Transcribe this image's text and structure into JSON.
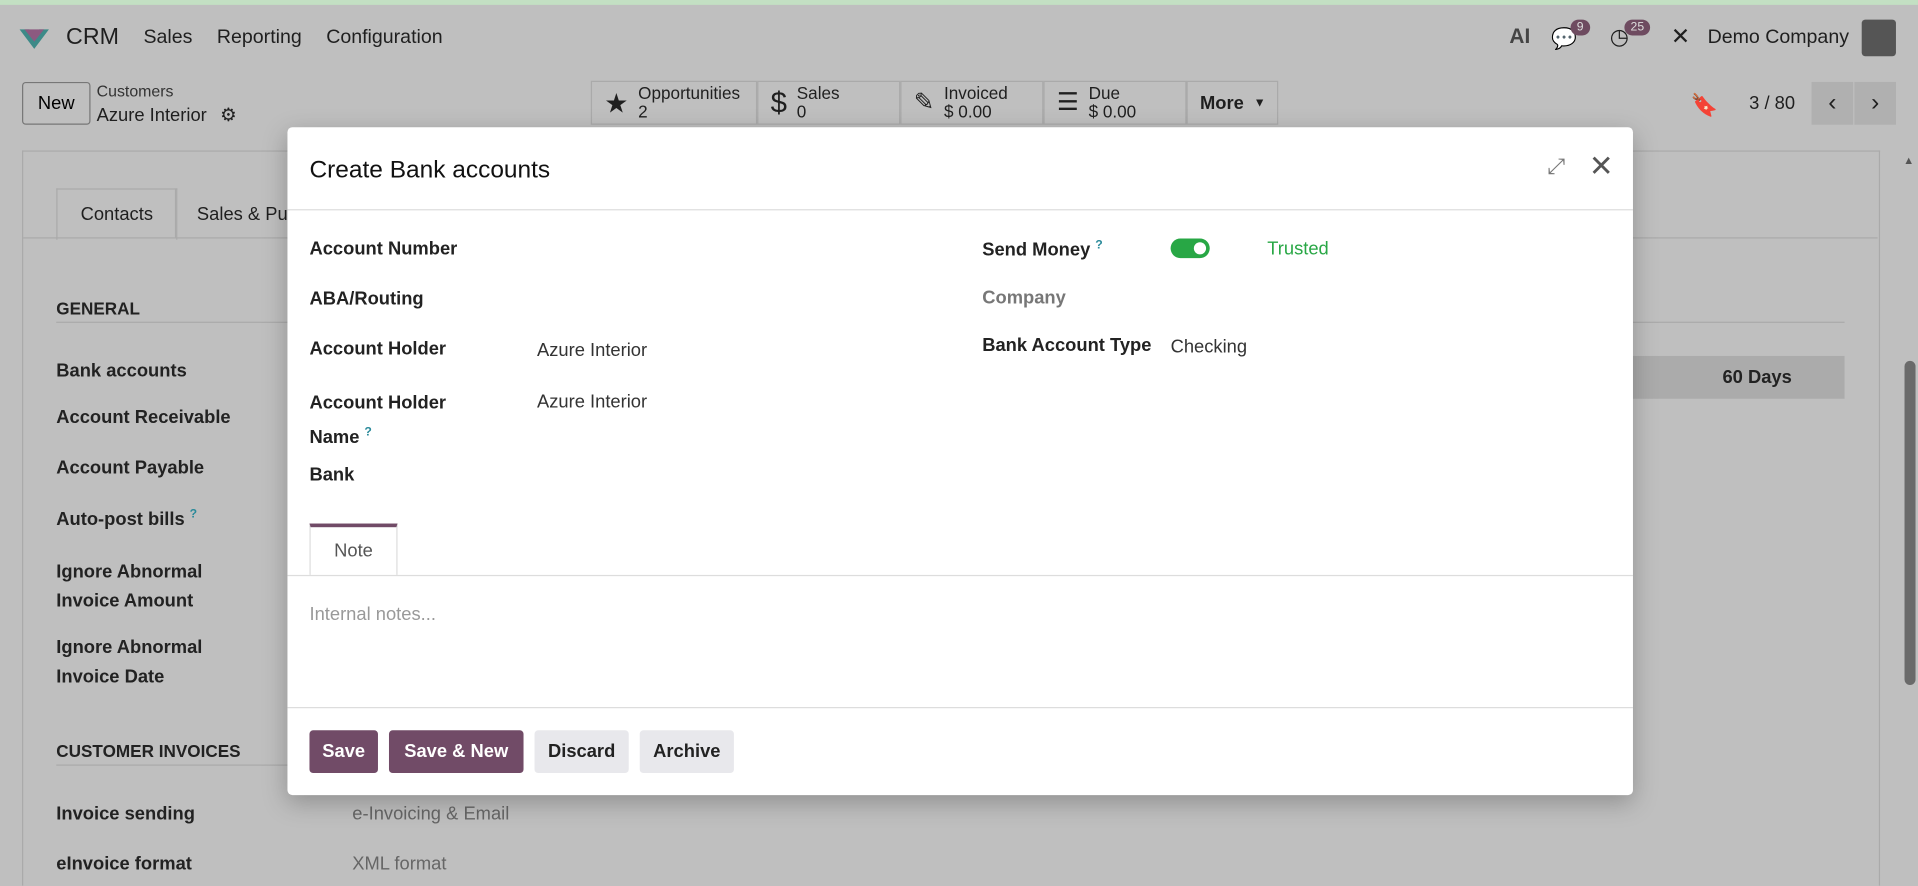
{
  "nav": {
    "app": "CRM",
    "menus": [
      "Sales",
      "Reporting",
      "Configuration"
    ],
    "messages_count": "9",
    "activities_count": "25",
    "company": "Demo Company",
    "ai_label": "AI"
  },
  "control": {
    "new_label": "New",
    "breadcrumb": "Customers",
    "record": "Azure Interior",
    "pager": "3 / 80",
    "more_label": "More"
  },
  "stats": [
    {
      "label": "Opportunities",
      "value": "2"
    },
    {
      "label": "Sales",
      "value": "0"
    },
    {
      "label": "Invoiced",
      "value": "$ 0.00"
    },
    {
      "label": "Due",
      "value": "$ 0.00"
    }
  ],
  "background": {
    "tabs": [
      "Contacts",
      "Sales & Pu"
    ],
    "general": "GENERAL",
    "fields": [
      "Bank accounts",
      "Account Receivable",
      "Account Payable",
      "Auto-post bills",
      "Ignore Abnormal Invoice Amount",
      "Ignore Abnormal Invoice Date"
    ],
    "customer_invoices": "CUSTOMER INVOICES",
    "invoice_sending": "Invoice sending",
    "invoice_sending_value": "e-Invoicing & Email",
    "einvoice_format": "eInvoice format",
    "einvoice_format_value": "XML format",
    "payment_term": "60 Days"
  },
  "modal": {
    "title": "Create Bank accounts",
    "left": {
      "account_number": "Account Number",
      "aba": "ABA/Routing",
      "holder": "Account Holder",
      "holder_value": "Azure Interior",
      "holder_name": "Account Holder Name",
      "holder_name_value": "Azure Interior",
      "bank": "Bank"
    },
    "right": {
      "send_money": "Send Money",
      "send_money_on": true,
      "trusted": "Trusted",
      "company": "Company",
      "type": "Bank Account Type",
      "type_value": "Checking"
    },
    "note_tab": "Note",
    "notes_placeholder": "Internal notes...",
    "buttons": {
      "save": "Save",
      "save_new": "Save & New",
      "discard": "Discard",
      "archive": "Archive"
    }
  },
  "colors": {
    "primary": "#714b67",
    "success": "#28a745"
  }
}
